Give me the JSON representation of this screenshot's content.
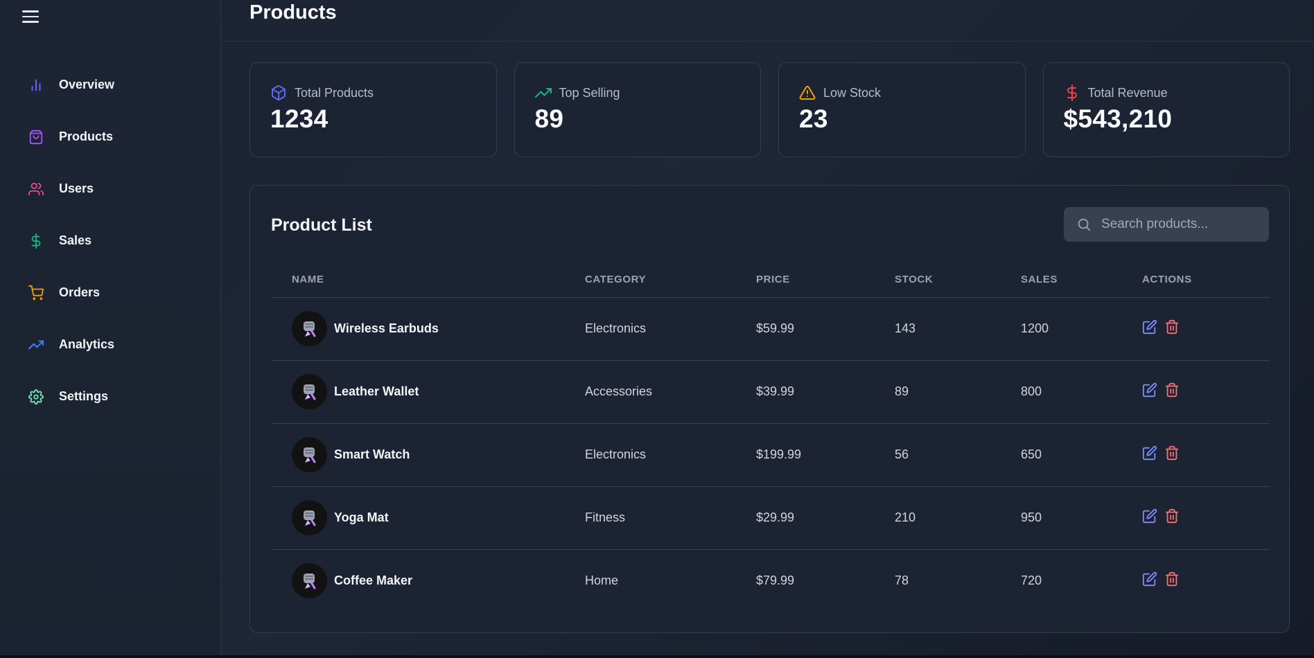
{
  "header": {
    "title": "Products"
  },
  "sidebar": {
    "items": [
      {
        "label": "Overview",
        "icon": "bar-chart-icon",
        "color": "#6366f1"
      },
      {
        "label": "Products",
        "icon": "shopping-bag-icon",
        "color": "#a855f7"
      },
      {
        "label": "Users",
        "icon": "users-icon",
        "color": "#ec4899"
      },
      {
        "label": "Sales",
        "icon": "dollar-sign-icon",
        "color": "#10b981"
      },
      {
        "label": "Orders",
        "icon": "shopping-cart-icon",
        "color": "#f59e0b"
      },
      {
        "label": "Analytics",
        "icon": "trending-up-icon",
        "color": "#3b82f6"
      },
      {
        "label": "Settings",
        "icon": "gear-icon",
        "color": "#6ee7b7"
      }
    ]
  },
  "stats": [
    {
      "label": "Total Products",
      "value": "1234",
      "icon": "package-icon",
      "color": "#6366f1"
    },
    {
      "label": "Top Selling",
      "value": "89",
      "icon": "trending-up-icon",
      "color": "#10b981"
    },
    {
      "label": "Low Stock",
      "value": "23",
      "icon": "alert-triangle-icon",
      "color": "#f59e0b"
    },
    {
      "label": "Total Revenue",
      "value": "$543,210",
      "icon": "dollar-sign-icon",
      "color": "#ef4444"
    }
  ],
  "product_list": {
    "title": "Product List",
    "search_placeholder": "Search products...",
    "columns": [
      "NAME",
      "CATEGORY",
      "PRICE",
      "STOCK",
      "SALES",
      "ACTIONS"
    ],
    "rows": [
      {
        "name": "Wireless Earbuds",
        "category": "Electronics",
        "price": "$59.99",
        "stock": "143",
        "sales": "1200"
      },
      {
        "name": "Leather Wallet",
        "category": "Accessories",
        "price": "$39.99",
        "stock": "89",
        "sales": "800"
      },
      {
        "name": "Smart Watch",
        "category": "Electronics",
        "price": "$199.99",
        "stock": "56",
        "sales": "650"
      },
      {
        "name": "Yoga Mat",
        "category": "Fitness",
        "price": "$29.99",
        "stock": "210",
        "sales": "950"
      },
      {
        "name": "Coffee Maker",
        "category": "Home",
        "price": "$79.99",
        "stock": "78",
        "sales": "720"
      }
    ],
    "action_colors": {
      "edit": "#818cf8",
      "delete": "#f87171"
    }
  }
}
